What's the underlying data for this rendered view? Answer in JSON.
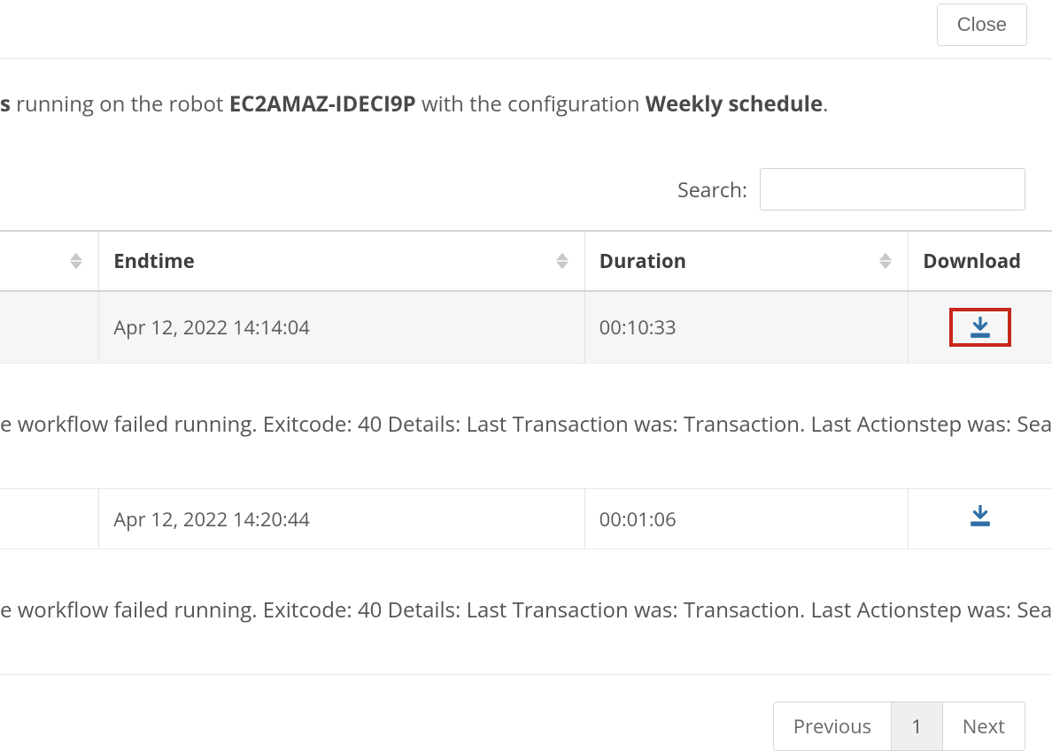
{
  "header": {
    "close_label": "Close"
  },
  "info": {
    "prefix": "s",
    "middle1": " running on the robot ",
    "robot": "EC2AMAZ-IDECI9P",
    "middle2": " with the configuration ",
    "config": "Weekly schedule",
    "suffix": "."
  },
  "search": {
    "label": "Search:",
    "value": ""
  },
  "columns": {
    "endtime": "Endtime",
    "duration": "Duration",
    "download": "Download"
  },
  "rows": [
    {
      "endtime": "Apr 12, 2022 14:14:04",
      "duration": "00:10:33",
      "detail": "e workflow failed running. Exitcode: 40 Details: Last Transaction was: Transaction. Last Actionstep was: Sea",
      "highlight": true
    },
    {
      "endtime": "Apr 12, 2022 14:20:44",
      "duration": "00:01:06",
      "detail": "e workflow failed running. Exitcode: 40 Details: Last Transaction was: Transaction. Last Actionstep was: Sea",
      "highlight": false
    }
  ],
  "pagination": {
    "previous": "Previous",
    "current": "1",
    "next": "Next"
  }
}
